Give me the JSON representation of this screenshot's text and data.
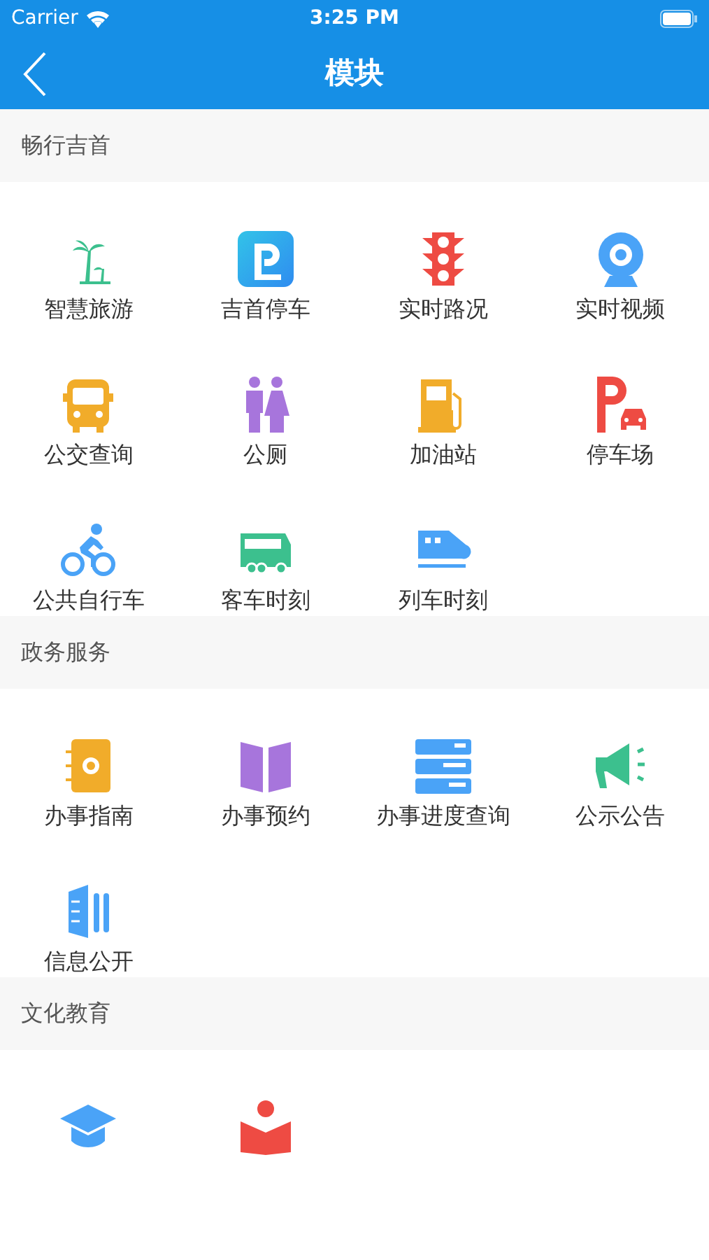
{
  "status_bar": {
    "carrier": "Carrier",
    "time": "3:25 PM"
  },
  "nav_bar": {
    "title": "模块"
  },
  "sections": [
    {
      "title": "畅行吉首",
      "items": [
        {
          "label": "智慧旅游",
          "kind": "palm",
          "color": "#3cc08e"
        },
        {
          "label": "吉首停车",
          "kind": "parking-app",
          "color": "#2f8cf0"
        },
        {
          "label": "实时路况",
          "kind": "traffic-light",
          "color": "#ee4b43"
        },
        {
          "label": "实时视频",
          "kind": "camera",
          "color": "#4aa3f7"
        },
        {
          "label": "公交查询",
          "kind": "bus",
          "color": "#f1ac2a"
        },
        {
          "label": "公厕",
          "kind": "toilet",
          "color": "#a775dc"
        },
        {
          "label": "加油站",
          "kind": "fuel",
          "color": "#f1ac2a"
        },
        {
          "label": "停车场",
          "kind": "parking-car",
          "color": "#ee4b43"
        },
        {
          "label": "公共自行车",
          "kind": "bike",
          "color": "#4aa3f7"
        },
        {
          "label": "客车时刻",
          "kind": "coach",
          "color": "#3cc08e"
        },
        {
          "label": "列车时刻",
          "kind": "train",
          "color": "#4aa3f7"
        }
      ]
    },
    {
      "title": "政务服务",
      "items": [
        {
          "label": "办事指南",
          "kind": "notebook",
          "color": "#f1ac2a"
        },
        {
          "label": "办事预约",
          "kind": "book",
          "color": "#a775dc"
        },
        {
          "label": "办事进度查询",
          "kind": "stack",
          "color": "#4aa3f7"
        },
        {
          "label": "公示公告",
          "kind": "megaphone",
          "color": "#3cc08e"
        },
        {
          "label": "信息公开",
          "kind": "doc",
          "color": "#4aa3f7"
        }
      ]
    },
    {
      "title": "文化教育",
      "items": [
        {
          "kind": "cap",
          "color": "#4aa3f7"
        },
        {
          "kind": "reader",
          "color": "#ee4b43"
        }
      ]
    }
  ]
}
